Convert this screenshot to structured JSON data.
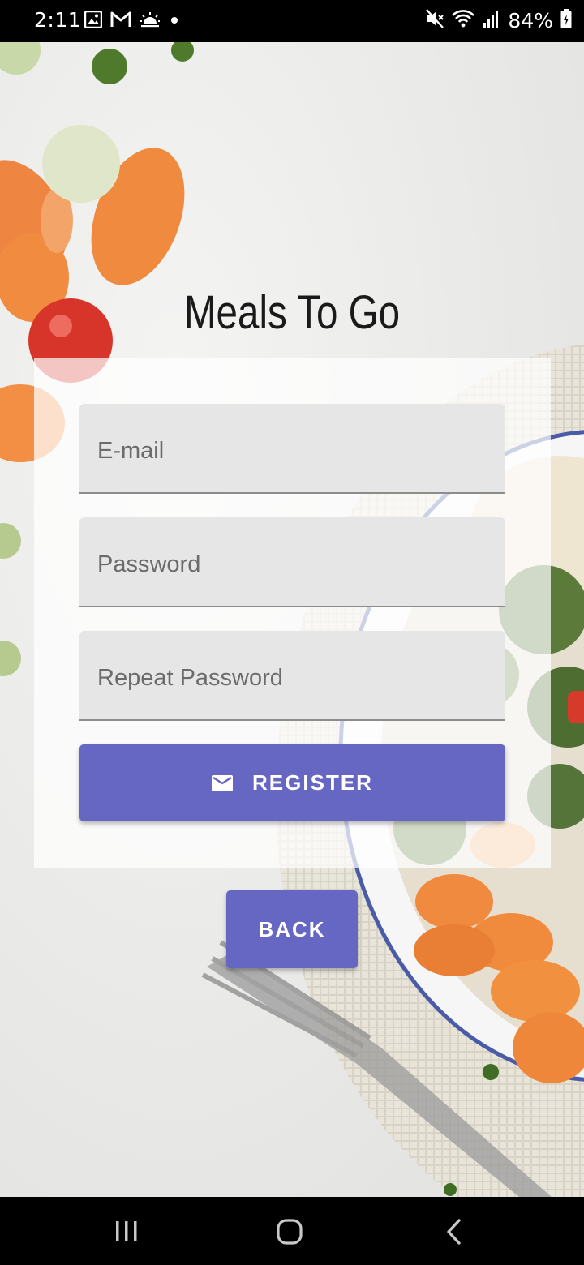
{
  "status_bar": {
    "time": "2:11",
    "battery": "84%",
    "left_icons": [
      "gallery-icon",
      "gmail-icon",
      "weather-icon",
      "dot-icon"
    ],
    "right_icons": [
      "mute-icon",
      "wifi-icon",
      "signal-icon",
      "battery-icon"
    ]
  },
  "app": {
    "title": "Meals To Go"
  },
  "form": {
    "email_placeholder": "E-mail",
    "password_placeholder": "Password",
    "repeat_password_placeholder": "Repeat Password",
    "register_label": "REGISTER",
    "register_icon": "email-icon",
    "back_label": "BACK"
  },
  "colors": {
    "accent": "#6667c3",
    "field_bg": "#e6e6e6"
  },
  "nav_bar": {
    "buttons": [
      "recent-apps",
      "home",
      "back"
    ]
  }
}
